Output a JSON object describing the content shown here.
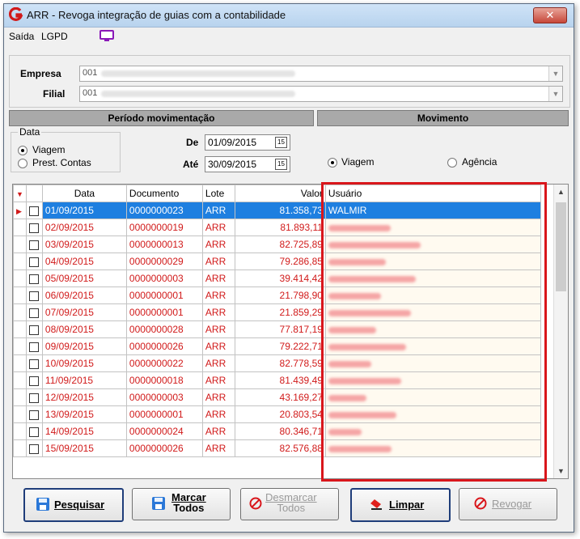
{
  "window": {
    "title": "ARR - Revoga integração de guias com a contabilidade",
    "close_symbol": "✕"
  },
  "menu": [
    "Saída",
    "LGPD"
  ],
  "empresa": {
    "label": "Empresa",
    "code": "001"
  },
  "filial": {
    "label": "Filial",
    "code": "001"
  },
  "periodo": {
    "header": "Período movimentação",
    "data_group_label": "Data",
    "options": [
      "Viagem",
      "Prest. Contas"
    ],
    "selected": "Viagem",
    "de_label": "De",
    "de_value": "01/09/2015",
    "ate_label": "Até",
    "ate_value": "30/09/2015"
  },
  "movimento": {
    "header": "Movimento",
    "options": [
      "Viagem",
      "Agência"
    ],
    "selected": "Viagem"
  },
  "grid": {
    "columns": [
      "Data",
      "Documento",
      "Lote",
      "Valor",
      "Usuário"
    ],
    "rows": [
      {
        "data": "01/09/2015",
        "documento": "0000000023",
        "lote": "ARR",
        "valor": "81.358,73",
        "usuario": "WALMIR"
      },
      {
        "data": "02/09/2015",
        "documento": "0000000019",
        "lote": "ARR",
        "valor": "81.893,11",
        "usuario": ""
      },
      {
        "data": "03/09/2015",
        "documento": "0000000013",
        "lote": "ARR",
        "valor": "82.725,89",
        "usuario": ""
      },
      {
        "data": "04/09/2015",
        "documento": "0000000029",
        "lote": "ARR",
        "valor": "79.286,85",
        "usuario": ""
      },
      {
        "data": "05/09/2015",
        "documento": "0000000003",
        "lote": "ARR",
        "valor": "39.414,42",
        "usuario": ""
      },
      {
        "data": "06/09/2015",
        "documento": "0000000001",
        "lote": "ARR",
        "valor": "21.798,90",
        "usuario": ""
      },
      {
        "data": "07/09/2015",
        "documento": "0000000001",
        "lote": "ARR",
        "valor": "21.859,29",
        "usuario": ""
      },
      {
        "data": "08/09/2015",
        "documento": "0000000028",
        "lote": "ARR",
        "valor": "77.817,19",
        "usuario": ""
      },
      {
        "data": "09/09/2015",
        "documento": "0000000026",
        "lote": "ARR",
        "valor": "79.222,71",
        "usuario": ""
      },
      {
        "data": "10/09/2015",
        "documento": "0000000022",
        "lote": "ARR",
        "valor": "82.778,59",
        "usuario": ""
      },
      {
        "data": "11/09/2015",
        "documento": "0000000018",
        "lote": "ARR",
        "valor": "81.439,49",
        "usuario": ""
      },
      {
        "data": "12/09/2015",
        "documento": "0000000003",
        "lote": "ARR",
        "valor": "43.169,27",
        "usuario": ""
      },
      {
        "data": "13/09/2015",
        "documento": "0000000001",
        "lote": "ARR",
        "valor": "20.803,54",
        "usuario": ""
      },
      {
        "data": "14/09/2015",
        "documento": "0000000024",
        "lote": "ARR",
        "valor": "80.346,71",
        "usuario": ""
      },
      {
        "data": "15/09/2015",
        "documento": "0000000026",
        "lote": "ARR",
        "valor": "82.576,88",
        "usuario": ""
      }
    ]
  },
  "buttons": {
    "pesquisar": "Pesquisar",
    "marcar_line1": "Marcar",
    "marcar_line2": "Todos",
    "desmarcar_line1": "Desmarcar",
    "desmarcar_line2": "Todos",
    "limpar": "Limpar",
    "revogar": "Revogar"
  },
  "colors": {
    "accent_red": "#d9161b",
    "selection_blue": "#1e7fe0",
    "row_text_red": "#d11a1a"
  }
}
